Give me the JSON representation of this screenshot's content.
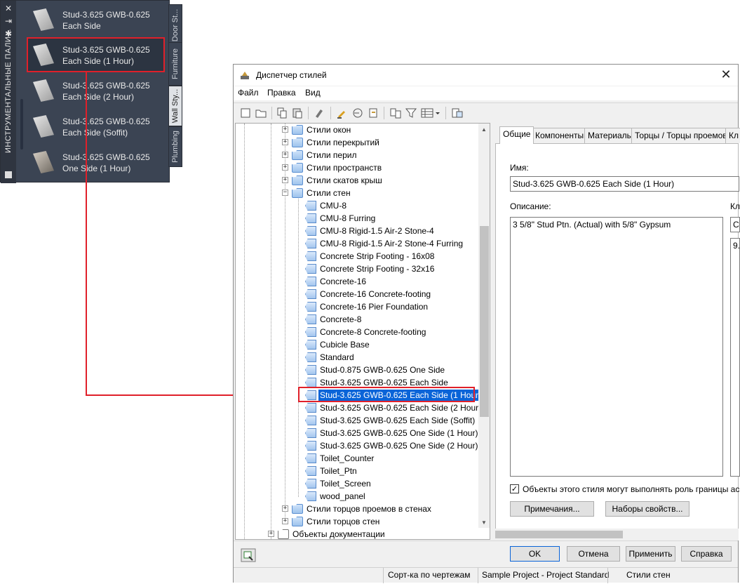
{
  "palette": {
    "title": "ИНСТРУМЕНТАЛЬНЫЕ ПАЛИ...",
    "items": [
      {
        "line1": "Stud-3.625 GWB-0.625",
        "line2": "Each Side"
      },
      {
        "line1": "Stud-3.625 GWB-0.625",
        "line2": "Each Side (1 Hour)"
      },
      {
        "line1": "Stud-3.625 GWB-0.625",
        "line2": "Each Side (2 Hour)"
      },
      {
        "line1": "Stud-3.625 GWB-0.625",
        "line2": "Each Side (Soffit)"
      },
      {
        "line1": "Stud-3.625 GWB-0.625",
        "line2": "One Side (1 Hour)"
      }
    ],
    "tabs": [
      "Door St...",
      "Furniture",
      "Wall Sty...",
      "Plumbing"
    ]
  },
  "dialog": {
    "title": "Диспетчер стилей",
    "menu": [
      "Файл",
      "Правка",
      "Вид"
    ],
    "tree": {
      "categories_top": [
        "Стили окон",
        "Стили перекрытий",
        "Стили перил",
        "Стили пространств",
        "Стили скатов крыш",
        "Стили стен"
      ],
      "wall_styles": [
        "CMU-8",
        "CMU-8 Furring",
        "CMU-8 Rigid-1.5 Air-2 Stone-4",
        "CMU-8 Rigid-1.5 Air-2 Stone-4 Furring",
        "Concrete Strip Footing - 16x08",
        "Concrete Strip Footing - 32x16",
        "Concrete-16",
        "Concrete-16 Concrete-footing",
        "Concrete-16 Pier Foundation",
        "Concrete-8",
        "Concrete-8 Concrete-footing",
        "Cubicle Base",
        "Standard",
        "Stud-0.875 GWB-0.625 One Side",
        "Stud-3.625 GWB-0.625 Each Side",
        "Stud-3.625 GWB-0.625 Each Side (1 Hour)",
        "Stud-3.625 GWB-0.625 Each Side (2 Hour)",
        "Stud-3.625 GWB-0.625 Each Side (Soffit)",
        "Stud-3.625 GWB-0.625 One Side (1 Hour)",
        "Stud-3.625 GWB-0.625 One Side (2 Hour)",
        "Toilet_Counter",
        "Toilet_Ptn",
        "Toilet_Screen",
        "wood_panel"
      ],
      "categories_bottom": [
        "Стили торцов проемов в стенах",
        "Стили торцов стен"
      ],
      "documentation": "Объекты документации",
      "selected": "Stud-3.625 GWB-0.625 Each Side (1 Hour)"
    },
    "tabs": [
      "Общие",
      "Компоненты",
      "Материалы",
      "Торцы / Торцы проемов",
      "Кл"
    ],
    "general": {
      "name_label": "Имя:",
      "name_value": "Stud-3.625 GWB-0.625 Each Side (1 Hour)",
      "desc_label": "Описание:",
      "desc_value": "3 5/8\" Stud Ptn. (Actual) with 5/8\" Gypsum",
      "side_label": "Кл",
      "side_field1": "С",
      "side_field2": "9.",
      "checkbox_label": "Объекты этого стиля могут выполнять роль границы ассоци",
      "notes_button": "Примечания...",
      "propsets_button": "Наборы свойств..."
    },
    "buttons": {
      "ok": "OK",
      "cancel": "Отмена",
      "apply": "Применить",
      "help": "Справка"
    },
    "status": [
      "Сорт-ка по чертежам",
      "Sample Project - Project Standard",
      "Стили стен"
    ]
  }
}
